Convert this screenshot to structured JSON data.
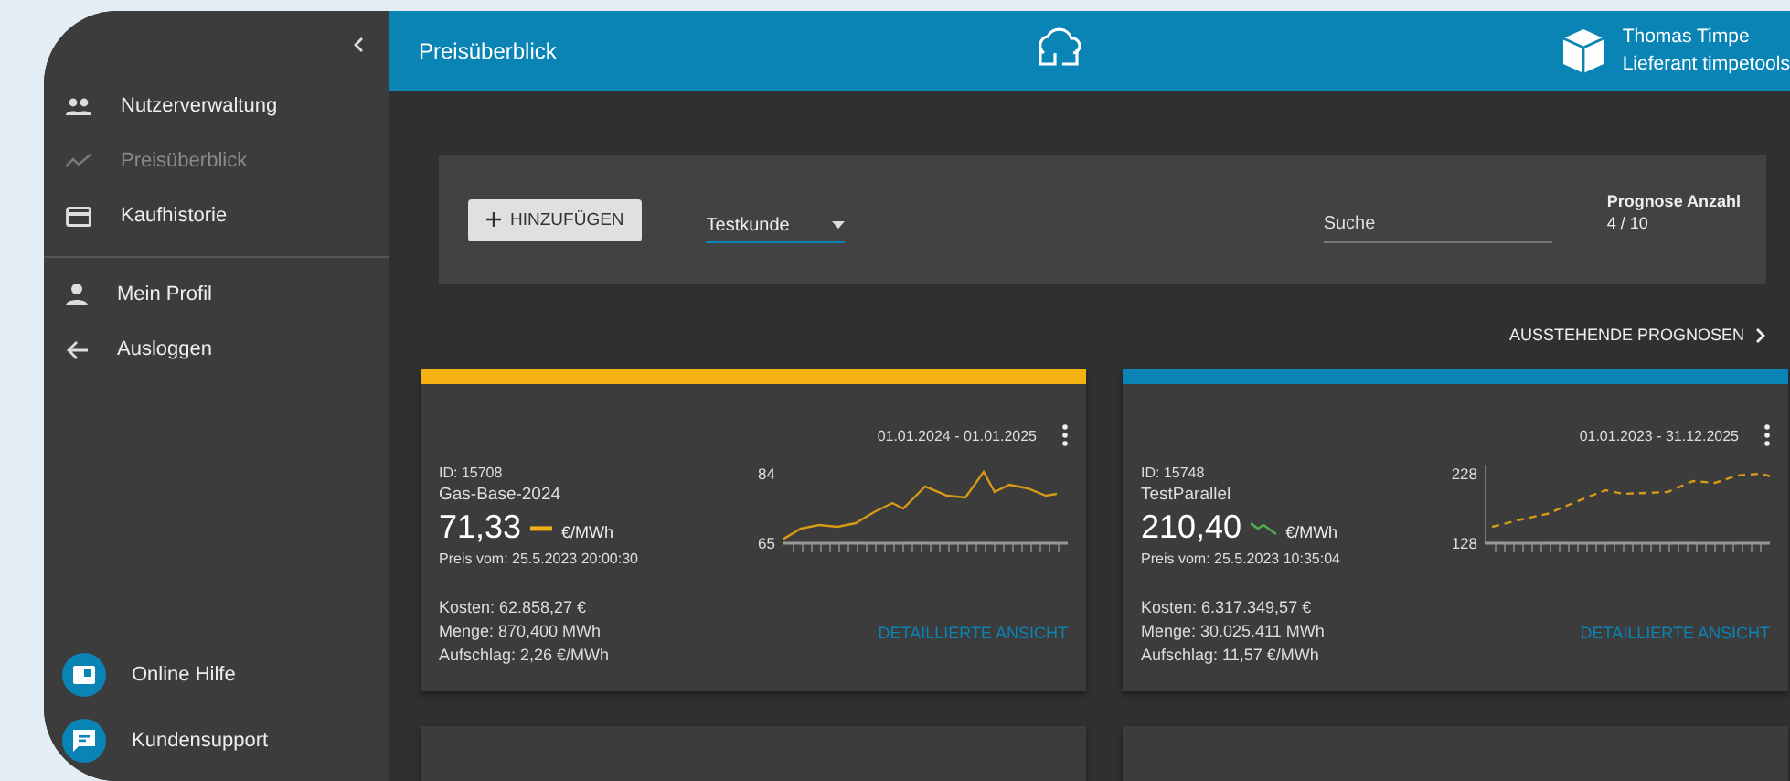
{
  "sidebar": {
    "items": [
      {
        "kind": "users",
        "label": "Nutzerverwaltung",
        "selected": false
      },
      {
        "kind": "chart",
        "label": "Preisüberblick",
        "selected": true
      },
      {
        "kind": "card",
        "label": "Kaufhistorie",
        "selected": false
      }
    ],
    "account_items": [
      {
        "kind": "person",
        "label": "Mein Profil"
      },
      {
        "kind": "logout",
        "label": "Ausloggen"
      }
    ],
    "help_items": [
      {
        "kind": "book",
        "label": "Online Hilfe"
      },
      {
        "kind": "chat",
        "label": "Kundensupport"
      }
    ]
  },
  "header": {
    "title": "Preisüberblick",
    "user_name": "Thomas Timpe",
    "user_role": "Lieferant timpetools"
  },
  "filter": {
    "add_button": "HINZUFÜGEN",
    "customer_select": "Testkunde",
    "search": {
      "placeholder": "Suche"
    },
    "forecast_label": "Prognose Anzahl",
    "forecast_count": "4 / 10"
  },
  "pending_link": "AUSSTEHENDE PROGNOSEN",
  "cards": [
    {
      "color": "#f5b014",
      "period": "01.01.2024 - 01.01.2025",
      "id": "ID: 15708",
      "name": "Gas-Base-2024",
      "price": "71,33",
      "kind": "flat",
      "unit": "€/MWh",
      "price_date": "Preis vom: 25.5.2023 20:00:30",
      "axis_max": "84",
      "axis_min": "65",
      "costs": "Kosten: 62.858,27 €",
      "quantity": "Menge: 870,400 MWh",
      "surcharge": "Aufschlag: 2,26 €/MWh",
      "details_link": "DETAILLIERTE ANSICHT"
    },
    {
      "color": "#0a84b4",
      "period": "01.01.2023 - 31.12.2025",
      "id": "ID: 15748",
      "name": "TestParallel",
      "price": "210,40",
      "kind": "down",
      "unit": "€/MWh",
      "price_date": "Preis vom: 25.5.2023 10:35:04",
      "axis_max": "228",
      "axis_min": "128",
      "costs": "Kosten: 6.317.349,57 €",
      "quantity": "Menge: 30.025.411 MWh",
      "surcharge": "Aufschlag: 11,57 €/MWh",
      "details_link": "DETAILLIERTE ANSICHT"
    }
  ],
  "more_cards": [
    {
      "color": "#3c3c3c"
    },
    {
      "color": "#3c3c3c"
    }
  ]
}
